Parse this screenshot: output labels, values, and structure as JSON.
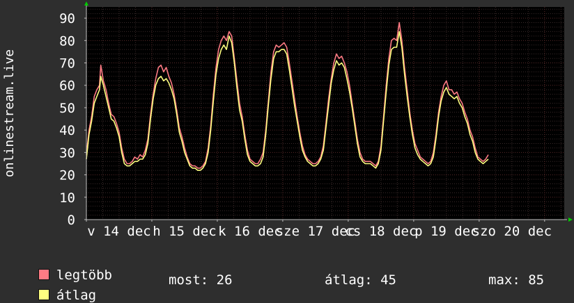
{
  "chart_data": {
    "type": "line",
    "ylabel": "onlinestream.live",
    "ylim": [
      0,
      95
    ],
    "yticks": [
      "0",
      "10",
      "20",
      "30",
      "40",
      "50",
      "60",
      "70",
      "80",
      "90"
    ],
    "xlim": [
      0,
      7.3
    ],
    "xtick_labels": [
      "v 14 dec",
      "h 15 dec",
      "k 16 dec",
      "sze 17 dec",
      "cs 18 dec",
      "p 19 dec",
      "szo 20 dec"
    ],
    "grid": true,
    "series": [
      {
        "name": "legtöbb",
        "color": "#ff7b84",
        "points": [
          [
            0.0,
            29
          ],
          [
            0.04,
            40
          ],
          [
            0.08,
            46
          ],
          [
            0.12,
            55
          ],
          [
            0.16,
            58
          ],
          [
            0.2,
            60
          ],
          [
            0.22,
            69
          ],
          [
            0.26,
            62
          ],
          [
            0.3,
            58
          ],
          [
            0.34,
            52
          ],
          [
            0.38,
            47
          ],
          [
            0.42,
            46
          ],
          [
            0.46,
            43
          ],
          [
            0.5,
            39
          ],
          [
            0.54,
            32
          ],
          [
            0.58,
            27
          ],
          [
            0.62,
            25
          ],
          [
            0.66,
            25
          ],
          [
            0.7,
            26
          ],
          [
            0.74,
            28
          ],
          [
            0.78,
            27
          ],
          [
            0.82,
            29
          ],
          [
            0.86,
            28
          ],
          [
            0.9,
            31
          ],
          [
            0.94,
            36
          ],
          [
            0.98,
            47
          ],
          [
            1.02,
            56
          ],
          [
            1.06,
            63
          ],
          [
            1.1,
            68
          ],
          [
            1.14,
            69
          ],
          [
            1.18,
            66
          ],
          [
            1.22,
            68
          ],
          [
            1.26,
            64
          ],
          [
            1.3,
            61
          ],
          [
            1.34,
            56
          ],
          [
            1.38,
            49
          ],
          [
            1.42,
            41
          ],
          [
            1.46,
            37
          ],
          [
            1.5,
            32
          ],
          [
            1.54,
            28
          ],
          [
            1.58,
            25
          ],
          [
            1.62,
            24
          ],
          [
            1.66,
            24
          ],
          [
            1.7,
            23
          ],
          [
            1.74,
            23
          ],
          [
            1.78,
            24
          ],
          [
            1.82,
            26
          ],
          [
            1.86,
            32
          ],
          [
            1.9,
            42
          ],
          [
            1.94,
            56
          ],
          [
            1.98,
            68
          ],
          [
            2.02,
            76
          ],
          [
            2.06,
            80
          ],
          [
            2.1,
            82
          ],
          [
            2.14,
            80
          ],
          [
            2.18,
            84
          ],
          [
            2.22,
            82
          ],
          [
            2.26,
            72
          ],
          [
            2.3,
            62
          ],
          [
            2.34,
            52
          ],
          [
            2.38,
            46
          ],
          [
            2.42,
            38
          ],
          [
            2.46,
            31
          ],
          [
            2.5,
            27
          ],
          [
            2.54,
            26
          ],
          [
            2.58,
            25
          ],
          [
            2.62,
            25
          ],
          [
            2.66,
            27
          ],
          [
            2.7,
            30
          ],
          [
            2.74,
            40
          ],
          [
            2.78,
            53
          ],
          [
            2.82,
            66
          ],
          [
            2.86,
            75
          ],
          [
            2.9,
            78
          ],
          [
            2.94,
            77
          ],
          [
            2.98,
            78
          ],
          [
            3.02,
            79
          ],
          [
            3.06,
            77
          ],
          [
            3.1,
            70
          ],
          [
            3.14,
            62
          ],
          [
            3.18,
            54
          ],
          [
            3.22,
            46
          ],
          [
            3.26,
            39
          ],
          [
            3.3,
            33
          ],
          [
            3.34,
            29
          ],
          [
            3.38,
            27
          ],
          [
            3.42,
            26
          ],
          [
            3.46,
            25
          ],
          [
            3.5,
            25
          ],
          [
            3.54,
            26
          ],
          [
            3.58,
            28
          ],
          [
            3.62,
            33
          ],
          [
            3.66,
            43
          ],
          [
            3.7,
            54
          ],
          [
            3.74,
            63
          ],
          [
            3.78,
            70
          ],
          [
            3.82,
            74
          ],
          [
            3.86,
            72
          ],
          [
            3.9,
            73
          ],
          [
            3.94,
            70
          ],
          [
            3.98,
            66
          ],
          [
            4.02,
            60
          ],
          [
            4.06,
            52
          ],
          [
            4.1,
            44
          ],
          [
            4.14,
            36
          ],
          [
            4.18,
            30
          ],
          [
            4.22,
            27
          ],
          [
            4.26,
            26
          ],
          [
            4.3,
            26
          ],
          [
            4.34,
            26
          ],
          [
            4.38,
            25
          ],
          [
            4.42,
            24
          ],
          [
            4.46,
            26
          ],
          [
            4.5,
            33
          ],
          [
            4.54,
            46
          ],
          [
            4.58,
            60
          ],
          [
            4.62,
            72
          ],
          [
            4.66,
            80
          ],
          [
            4.7,
            81
          ],
          [
            4.74,
            80
          ],
          [
            4.78,
            88
          ],
          [
            4.82,
            80
          ],
          [
            4.86,
            68
          ],
          [
            4.9,
            58
          ],
          [
            4.94,
            48
          ],
          [
            4.98,
            40
          ],
          [
            5.02,
            34
          ],
          [
            5.06,
            31
          ],
          [
            5.1,
            28
          ],
          [
            5.14,
            27
          ],
          [
            5.18,
            26
          ],
          [
            5.22,
            25
          ],
          [
            5.26,
            26
          ],
          [
            5.3,
            30
          ],
          [
            5.34,
            38
          ],
          [
            5.38,
            48
          ],
          [
            5.42,
            55
          ],
          [
            5.46,
            60
          ],
          [
            5.5,
            62
          ],
          [
            5.54,
            58
          ],
          [
            5.58,
            58
          ],
          [
            5.62,
            56
          ],
          [
            5.66,
            57
          ],
          [
            5.7,
            54
          ],
          [
            5.74,
            52
          ],
          [
            5.78,
            48
          ],
          [
            5.82,
            45
          ],
          [
            5.86,
            40
          ],
          [
            5.9,
            37
          ],
          [
            5.94,
            32
          ],
          [
            5.98,
            28
          ],
          [
            6.02,
            27
          ],
          [
            6.06,
            26
          ],
          [
            6.1,
            27
          ],
          [
            6.14,
            29
          ]
        ]
      },
      {
        "name": "átlag",
        "color": "#ffff80",
        "points": [
          [
            0.0,
            27
          ],
          [
            0.04,
            38
          ],
          [
            0.08,
            44
          ],
          [
            0.12,
            52
          ],
          [
            0.16,
            55
          ],
          [
            0.2,
            58
          ],
          [
            0.22,
            64
          ],
          [
            0.26,
            60
          ],
          [
            0.3,
            55
          ],
          [
            0.34,
            50
          ],
          [
            0.38,
            45
          ],
          [
            0.42,
            44
          ],
          [
            0.46,
            41
          ],
          [
            0.5,
            37
          ],
          [
            0.54,
            30
          ],
          [
            0.58,
            25
          ],
          [
            0.62,
            24
          ],
          [
            0.66,
            24
          ],
          [
            0.7,
            25
          ],
          [
            0.74,
            26
          ],
          [
            0.78,
            26
          ],
          [
            0.82,
            27
          ],
          [
            0.86,
            27
          ],
          [
            0.9,
            29
          ],
          [
            0.94,
            34
          ],
          [
            0.98,
            45
          ],
          [
            1.02,
            54
          ],
          [
            1.06,
            60
          ],
          [
            1.1,
            63
          ],
          [
            1.14,
            64
          ],
          [
            1.18,
            62
          ],
          [
            1.22,
            63
          ],
          [
            1.26,
            61
          ],
          [
            1.3,
            58
          ],
          [
            1.34,
            54
          ],
          [
            1.38,
            47
          ],
          [
            1.42,
            39
          ],
          [
            1.46,
            35
          ],
          [
            1.5,
            30
          ],
          [
            1.54,
            27
          ],
          [
            1.58,
            24
          ],
          [
            1.62,
            23
          ],
          [
            1.66,
            23
          ],
          [
            1.7,
            22
          ],
          [
            1.74,
            22
          ],
          [
            1.78,
            23
          ],
          [
            1.82,
            25
          ],
          [
            1.86,
            30
          ],
          [
            1.9,
            40
          ],
          [
            1.94,
            53
          ],
          [
            1.98,
            65
          ],
          [
            2.02,
            72
          ],
          [
            2.06,
            76
          ],
          [
            2.1,
            78
          ],
          [
            2.14,
            76
          ],
          [
            2.18,
            82
          ],
          [
            2.22,
            79
          ],
          [
            2.26,
            70
          ],
          [
            2.3,
            59
          ],
          [
            2.34,
            49
          ],
          [
            2.38,
            44
          ],
          [
            2.42,
            36
          ],
          [
            2.46,
            29
          ],
          [
            2.5,
            26
          ],
          [
            2.54,
            25
          ],
          [
            2.58,
            24
          ],
          [
            2.62,
            24
          ],
          [
            2.66,
            25
          ],
          [
            2.7,
            28
          ],
          [
            2.74,
            38
          ],
          [
            2.78,
            51
          ],
          [
            2.82,
            63
          ],
          [
            2.86,
            72
          ],
          [
            2.9,
            75
          ],
          [
            2.94,
            75
          ],
          [
            2.98,
            76
          ],
          [
            3.02,
            76
          ],
          [
            3.06,
            74
          ],
          [
            3.1,
            67
          ],
          [
            3.14,
            59
          ],
          [
            3.18,
            51
          ],
          [
            3.22,
            44
          ],
          [
            3.26,
            37
          ],
          [
            3.3,
            31
          ],
          [
            3.34,
            28
          ],
          [
            3.38,
            26
          ],
          [
            3.42,
            25
          ],
          [
            3.46,
            24
          ],
          [
            3.5,
            24
          ],
          [
            3.54,
            25
          ],
          [
            3.58,
            27
          ],
          [
            3.62,
            31
          ],
          [
            3.66,
            41
          ],
          [
            3.7,
            51
          ],
          [
            3.74,
            61
          ],
          [
            3.78,
            67
          ],
          [
            3.82,
            71
          ],
          [
            3.86,
            69
          ],
          [
            3.9,
            70
          ],
          [
            3.94,
            68
          ],
          [
            3.98,
            63
          ],
          [
            4.02,
            57
          ],
          [
            4.06,
            50
          ],
          [
            4.1,
            42
          ],
          [
            4.14,
            34
          ],
          [
            4.18,
            28
          ],
          [
            4.22,
            26
          ],
          [
            4.26,
            25
          ],
          [
            4.3,
            25
          ],
          [
            4.34,
            25
          ],
          [
            4.38,
            24
          ],
          [
            4.42,
            23
          ],
          [
            4.46,
            25
          ],
          [
            4.5,
            31
          ],
          [
            4.54,
            44
          ],
          [
            4.58,
            57
          ],
          [
            4.62,
            69
          ],
          [
            4.66,
            76
          ],
          [
            4.7,
            77
          ],
          [
            4.74,
            77
          ],
          [
            4.78,
            84
          ],
          [
            4.82,
            77
          ],
          [
            4.86,
            65
          ],
          [
            4.9,
            55
          ],
          [
            4.94,
            46
          ],
          [
            4.98,
            38
          ],
          [
            5.02,
            32
          ],
          [
            5.06,
            29
          ],
          [
            5.1,
            27
          ],
          [
            5.14,
            26
          ],
          [
            5.18,
            25
          ],
          [
            5.22,
            24
          ],
          [
            5.26,
            25
          ],
          [
            5.3,
            28
          ],
          [
            5.34,
            36
          ],
          [
            5.38,
            46
          ],
          [
            5.42,
            53
          ],
          [
            5.46,
            57
          ],
          [
            5.5,
            59
          ],
          [
            5.54,
            56
          ],
          [
            5.58,
            55
          ],
          [
            5.62,
            54
          ],
          [
            5.66,
            55
          ],
          [
            5.7,
            52
          ],
          [
            5.74,
            50
          ],
          [
            5.78,
            46
          ],
          [
            5.82,
            43
          ],
          [
            5.86,
            38
          ],
          [
            5.9,
            35
          ],
          [
            5.94,
            30
          ],
          [
            5.98,
            27
          ],
          [
            6.02,
            26
          ],
          [
            6.06,
            25
          ],
          [
            6.1,
            26
          ],
          [
            6.14,
            27
          ]
        ]
      }
    ]
  },
  "legend": {
    "max_label": "legtöbb",
    "avg_label": "átlag",
    "now_text": "most: 26",
    "avg_text": "átlag: 45",
    "maximum_text": "max: 85"
  },
  "colors": {
    "background": "#2e2e2e",
    "canvas": "#000000",
    "grid_minor": "#3a2a2a",
    "grid_major": "#5a2a2a",
    "axis": "#c0c0c0",
    "arrow": "#00cc00"
  }
}
